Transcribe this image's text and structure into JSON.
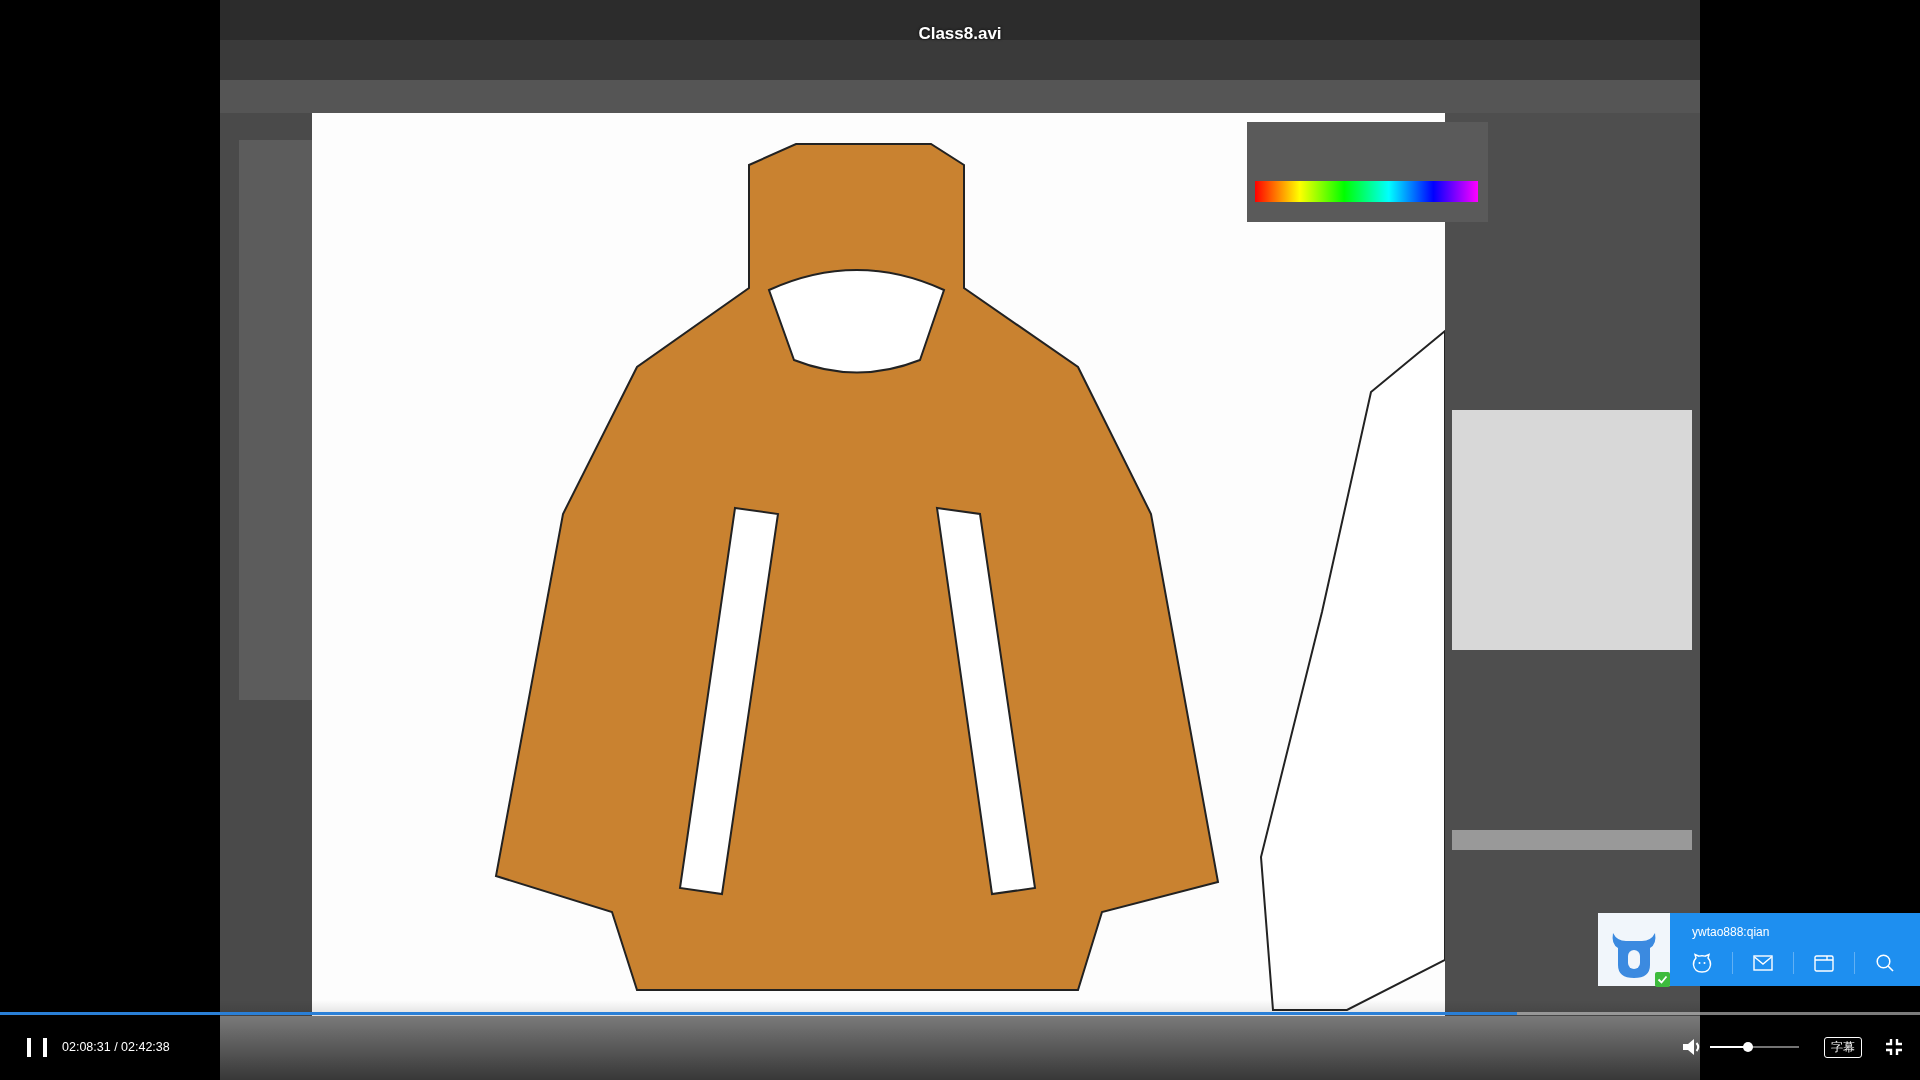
{
  "player": {
    "title": "Class8.avi",
    "playing": true,
    "progress": {
      "level": 0.79
    },
    "time": "02:08:31 / 02:42:38",
    "volume": {
      "level": 0.43
    },
    "subtitle_button": "字幕",
    "fullscreen": true
  },
  "notification": {
    "username": "ywtao888:qian",
    "online": true
  }
}
